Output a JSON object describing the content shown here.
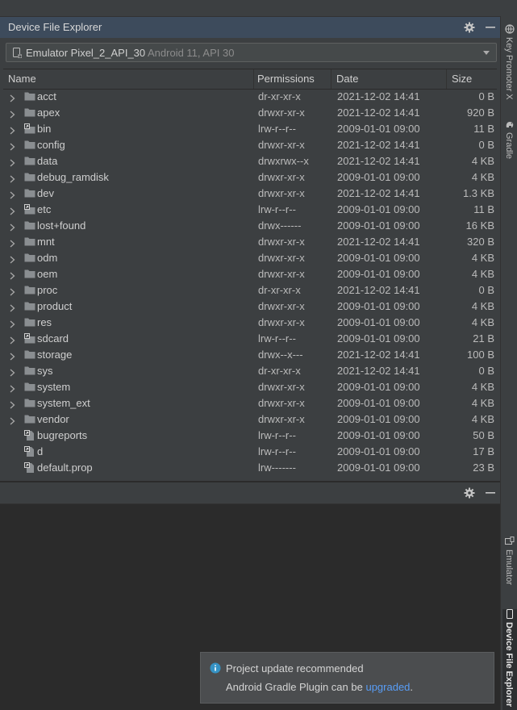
{
  "panel": {
    "title": "Device File Explorer",
    "device_name": "Emulator Pixel_2_API_30",
    "device_detail": "Android 11, API 30"
  },
  "columns": [
    "Name",
    "Permissions",
    "Date",
    "Size"
  ],
  "files": [
    {
      "name": "acct",
      "type": "folder",
      "permissions": "dr-xr-xr-x",
      "date": "2021-12-02 14:41",
      "size": "0 B"
    },
    {
      "name": "apex",
      "type": "folder",
      "permissions": "drwxr-xr-x",
      "date": "2021-12-02 14:41",
      "size": "920 B"
    },
    {
      "name": "bin",
      "type": "link-folder",
      "permissions": "lrw-r--r--",
      "date": "2009-01-01 09:00",
      "size": "11 B"
    },
    {
      "name": "config",
      "type": "folder",
      "permissions": "drwxr-xr-x",
      "date": "2021-12-02 14:41",
      "size": "0 B"
    },
    {
      "name": "data",
      "type": "folder",
      "permissions": "drwxrwx--x",
      "date": "2021-12-02 14:41",
      "size": "4 KB"
    },
    {
      "name": "debug_ramdisk",
      "type": "folder",
      "permissions": "drwxr-xr-x",
      "date": "2009-01-01 09:00",
      "size": "4 KB"
    },
    {
      "name": "dev",
      "type": "folder",
      "permissions": "drwxr-xr-x",
      "date": "2021-12-02 14:41",
      "size": "1.3 KB"
    },
    {
      "name": "etc",
      "type": "link-folder",
      "permissions": "lrw-r--r--",
      "date": "2009-01-01 09:00",
      "size": "11 B"
    },
    {
      "name": "lost+found",
      "type": "folder",
      "permissions": "drwx------",
      "date": "2009-01-01 09:00",
      "size": "16 KB"
    },
    {
      "name": "mnt",
      "type": "folder",
      "permissions": "drwxr-xr-x",
      "date": "2021-12-02 14:41",
      "size": "320 B"
    },
    {
      "name": "odm",
      "type": "folder",
      "permissions": "drwxr-xr-x",
      "date": "2009-01-01 09:00",
      "size": "4 KB"
    },
    {
      "name": "oem",
      "type": "folder",
      "permissions": "drwxr-xr-x",
      "date": "2009-01-01 09:00",
      "size": "4 KB"
    },
    {
      "name": "proc",
      "type": "folder",
      "permissions": "dr-xr-xr-x",
      "date": "2021-12-02 14:41",
      "size": "0 B"
    },
    {
      "name": "product",
      "type": "folder",
      "permissions": "drwxr-xr-x",
      "date": "2009-01-01 09:00",
      "size": "4 KB"
    },
    {
      "name": "res",
      "type": "folder",
      "permissions": "drwxr-xr-x",
      "date": "2009-01-01 09:00",
      "size": "4 KB"
    },
    {
      "name": "sdcard",
      "type": "link-folder",
      "permissions": "lrw-r--r--",
      "date": "2009-01-01 09:00",
      "size": "21 B"
    },
    {
      "name": "storage",
      "type": "folder",
      "permissions": "drwx--x---",
      "date": "2021-12-02 14:41",
      "size": "100 B"
    },
    {
      "name": "sys",
      "type": "folder",
      "permissions": "dr-xr-xr-x",
      "date": "2021-12-02 14:41",
      "size": "0 B"
    },
    {
      "name": "system",
      "type": "folder",
      "permissions": "drwxr-xr-x",
      "date": "2009-01-01 09:00",
      "size": "4 KB"
    },
    {
      "name": "system_ext",
      "type": "folder",
      "permissions": "drwxr-xr-x",
      "date": "2009-01-01 09:00",
      "size": "4 KB"
    },
    {
      "name": "vendor",
      "type": "folder",
      "permissions": "drwxr-xr-x",
      "date": "2009-01-01 09:00",
      "size": "4 KB"
    },
    {
      "name": "bugreports",
      "type": "link-file",
      "permissions": "lrw-r--r--",
      "date": "2009-01-01 09:00",
      "size": "50 B"
    },
    {
      "name": "d",
      "type": "link-file",
      "permissions": "lrw-r--r--",
      "date": "2009-01-01 09:00",
      "size": "17 B"
    },
    {
      "name": "default.prop",
      "type": "link-file",
      "permissions": "lrw-------",
      "date": "2009-01-01 09:00",
      "size": "23 B"
    }
  ],
  "right_tabs": {
    "key_promoter": "Key Promoter X",
    "gradle": "Gradle",
    "emulator": "Emulator",
    "device_file_explorer": "Device File Explorer"
  },
  "notification": {
    "title": "Project update recommended",
    "message": "Android Gradle Plugin can be",
    "link": "upgraded",
    "suffix": "."
  },
  "icons": {
    "settings": "gear-icon",
    "hide": "minimize-icon",
    "device": "phone-icon",
    "folder": "folder-icon",
    "expand": "chevron-right-icon",
    "info": "info-icon"
  },
  "colors": {
    "accent": "#589df6",
    "panel_header": "#3d4b5c",
    "background": "#3c3f41"
  }
}
